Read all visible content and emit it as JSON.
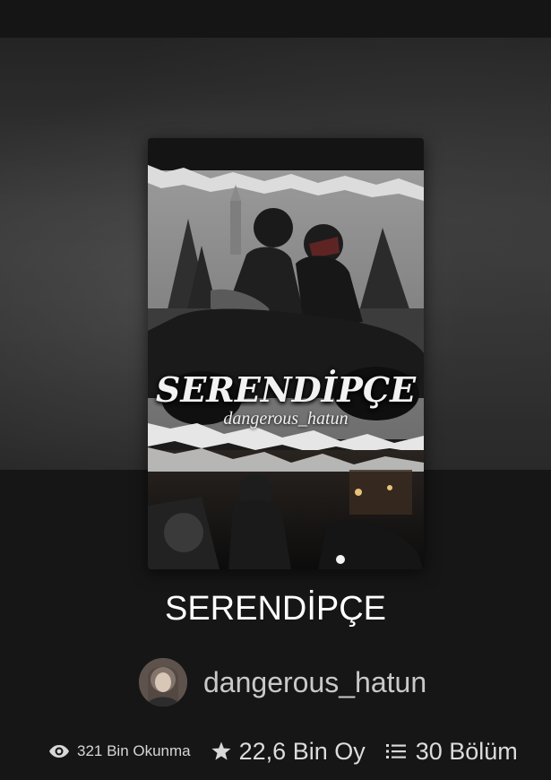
{
  "story": {
    "cover_title": "SERENDİPÇE",
    "cover_author": "dangerous_hatun",
    "title": "SERENDİPÇE"
  },
  "author": {
    "username": "dangerous_hatun"
  },
  "stats": {
    "reads": "321 Bin Okunma",
    "votes": "22,6 Bin Oy",
    "parts": "30 Bölüm"
  },
  "icons": {
    "reads": "eye-icon",
    "votes": "star-icon",
    "parts": "list-icon"
  }
}
